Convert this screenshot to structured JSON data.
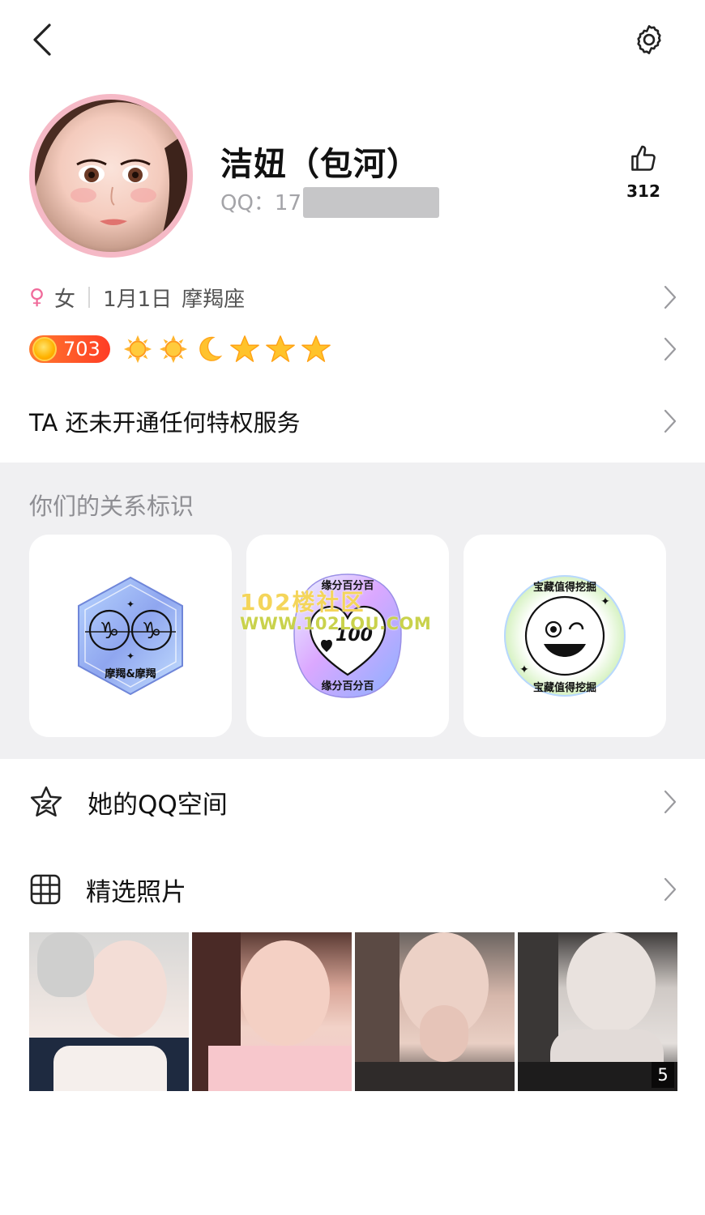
{
  "profile": {
    "name": "洁妞（包河）",
    "qq_label": "QQ：171",
    "likes": "312",
    "gender_symbol": "♀",
    "gender": "女",
    "birthday": "1月1日",
    "zodiac": "摩羯座",
    "level": "703",
    "level_icons": [
      "sun-icon",
      "sun-icon",
      "moon-icon",
      "star-icon",
      "star-icon",
      "star-icon"
    ],
    "privilege_text": "TA 还未开通任何特权服务"
  },
  "relationship": {
    "title": "你们的关系标识",
    "badges": [
      {
        "name": "capricorn-badge",
        "label": "摩羯&摩羯"
      },
      {
        "name": "hundred-percent-badge",
        "top_text": "缘分百分百",
        "bottom_text": "缘分百分百",
        "score": "100"
      },
      {
        "name": "treasure-badge",
        "top_text": "宝藏值得挖掘",
        "bottom_text": "宝藏值得挖掘"
      }
    ]
  },
  "watermark": {
    "line1": "102楼社区",
    "line2": "WWW.102LOU.COM"
  },
  "list": {
    "qzone_label": "她的QQ空间",
    "photos_label": "精选照片"
  },
  "photos": {
    "more_count": "5"
  },
  "colors": {
    "accent_pink": "#f5b9c6",
    "level_orange": "#ff5a25",
    "section_gray": "#f0f0f2",
    "secondary_text": "#8e8e93"
  }
}
